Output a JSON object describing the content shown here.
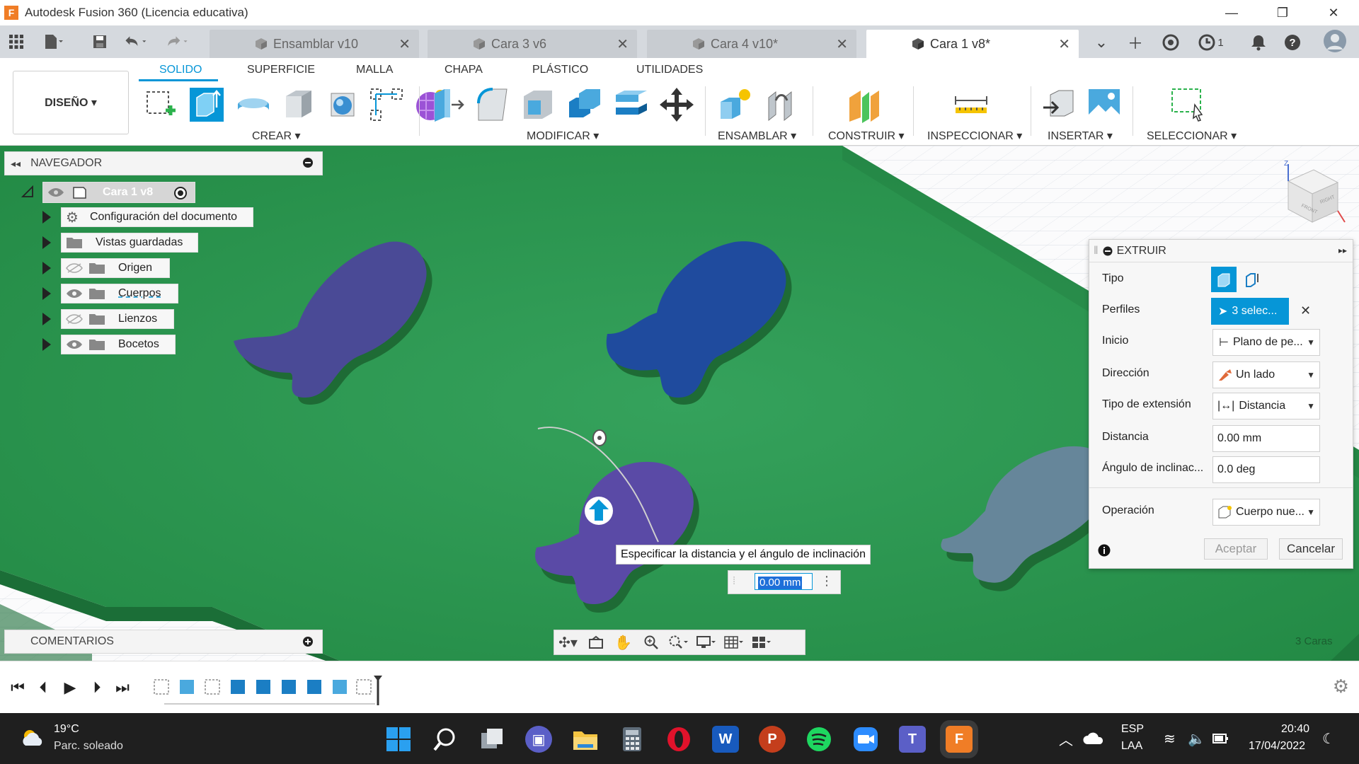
{
  "window": {
    "title": "Autodesk Fusion 360 (Licencia educativa)",
    "logo_letter": "F",
    "minimize": "—",
    "restore": "❐",
    "close": "✕"
  },
  "tabs": [
    {
      "label": "Ensamblar v10",
      "active": false
    },
    {
      "label": "Cara 3 v6",
      "active": false
    },
    {
      "label": "Cara 4 v10*",
      "active": false
    },
    {
      "label": "Cara 1 v8*",
      "active": true
    }
  ],
  "tabbar_right": {
    "jobs_count": "1"
  },
  "ribbon": {
    "tabs": [
      "SOLIDO",
      "SUPERFICIE",
      "MALLA",
      "CHAPA",
      "PLÁSTICO",
      "UTILIDADES"
    ],
    "workspace": "DISEÑO ▾",
    "groups": [
      "CREAR ▾",
      "MODIFICAR ▾",
      "ENSAMBLAR ▾",
      "CONSTRUIR ▾",
      "INSPECCIONAR ▾",
      "INSERTAR ▾",
      "SELECCIONAR ▾"
    ]
  },
  "browser": {
    "title": "NAVEGADOR",
    "root": "Cara 1 v8",
    "items": [
      "Configuración del documento",
      "Vistas guardadas",
      "Origen",
      "Cuerpos",
      "Lienzos",
      "Bocetos"
    ]
  },
  "comments": {
    "title": "COMENTARIOS"
  },
  "extrude": {
    "title": "EXTRUIR",
    "rows": [
      {
        "label": "Tipo"
      },
      {
        "label": "Perfiles",
        "value": "3 selec..."
      },
      {
        "label": "Inicio",
        "value": "Plano de pe..."
      },
      {
        "label": "Dirección",
        "value": "Un lado"
      },
      {
        "label": "Tipo de extensión",
        "value": "Distancia"
      },
      {
        "label": "Distancia",
        "value": "0.00 mm"
      },
      {
        "label": "Ángulo de inclinac...",
        "value": "0.0 deg"
      },
      {
        "label": "Operación",
        "value": "Cuerpo nue..."
      }
    ],
    "ok": "Aceptar",
    "cancel": "Cancelar"
  },
  "canvas": {
    "tooltip": "Especificar la distancia y el ángulo de inclinación",
    "distance_input": "0.00 mm",
    "selection_count": "3 Caras"
  },
  "viewcube": {
    "axis_z": "Z",
    "face_front": "FRONT",
    "face_right": "RIGHT"
  },
  "colors": {
    "accent": "#0696d7",
    "ground": "#2e9a55",
    "fish1": "#4a4a96",
    "fish2": "#1f4b9e",
    "fish3": "#5a4aa6",
    "fish4": "#66869a"
  },
  "taskbar": {
    "weather_temp": "19°C",
    "weather_desc": "Parc. soleado",
    "lang1": "ESP",
    "lang2": "LAA",
    "time": "20:40",
    "date": "17/04/2022"
  }
}
